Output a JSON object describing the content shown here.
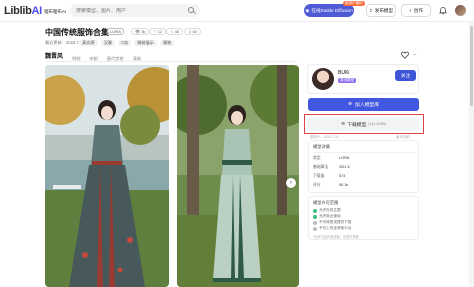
{
  "header": {
    "logo_text": "Liblib",
    "logo_ai": "AI",
    "logo_sub": "哩布哩布AI",
    "search_placeholder": "搜索模型、图片、用户",
    "sd_button": "在线Stable Diffusion",
    "sd_badge": "新用户福利",
    "publish_button": "发布模型",
    "create_button": "创作"
  },
  "model": {
    "title": "中国传统服饰合集",
    "type_tag": "LORA",
    "stats": [
      "3k",
      "12",
      "45",
      "60"
    ],
    "meta": "最近更新：2023.7.31",
    "tags": [
      "真实感",
      "汉服",
      "C站",
      "服装展示",
      "服装"
    ],
    "tabs": [
      "魏晋风",
      "明制",
      "宋制",
      "唐代宫装",
      "清制"
    ]
  },
  "author": {
    "name": "BUKi",
    "badge": "原创模型",
    "follow": "关注"
  },
  "actions": {
    "add_library": "加入模型库",
    "download": "下载模型",
    "download_size": "(144.11MB)",
    "updated": "更新于：2023.7.31",
    "updated_right": "版本说明"
  },
  "info": {
    "title": "模型详情",
    "rows": [
      {
        "k": "类型",
        "v": "LORA"
      },
      {
        "k": "基础算法",
        "v": "SD1.5"
      },
      {
        "k": "下载量",
        "v": "574"
      },
      {
        "k": "评分",
        "v": "90.1k"
      }
    ]
  },
  "license": {
    "title": "模型许可范围",
    "items": [
      {
        "text": "允许在线生图",
        "ok": true
      },
      {
        "text": "允许商业使用",
        "ok": true
      },
      {
        "text": "不可转售或提供下载",
        "ok": false
      },
      {
        "text": "不可上传至其他平台",
        "ok": false
      }
    ],
    "note": "*此许可由作者设置，请遵守条款"
  },
  "colors": {
    "accent": "#4257e0",
    "highlight": "#e14444",
    "badge": "#8c6cf0"
  }
}
